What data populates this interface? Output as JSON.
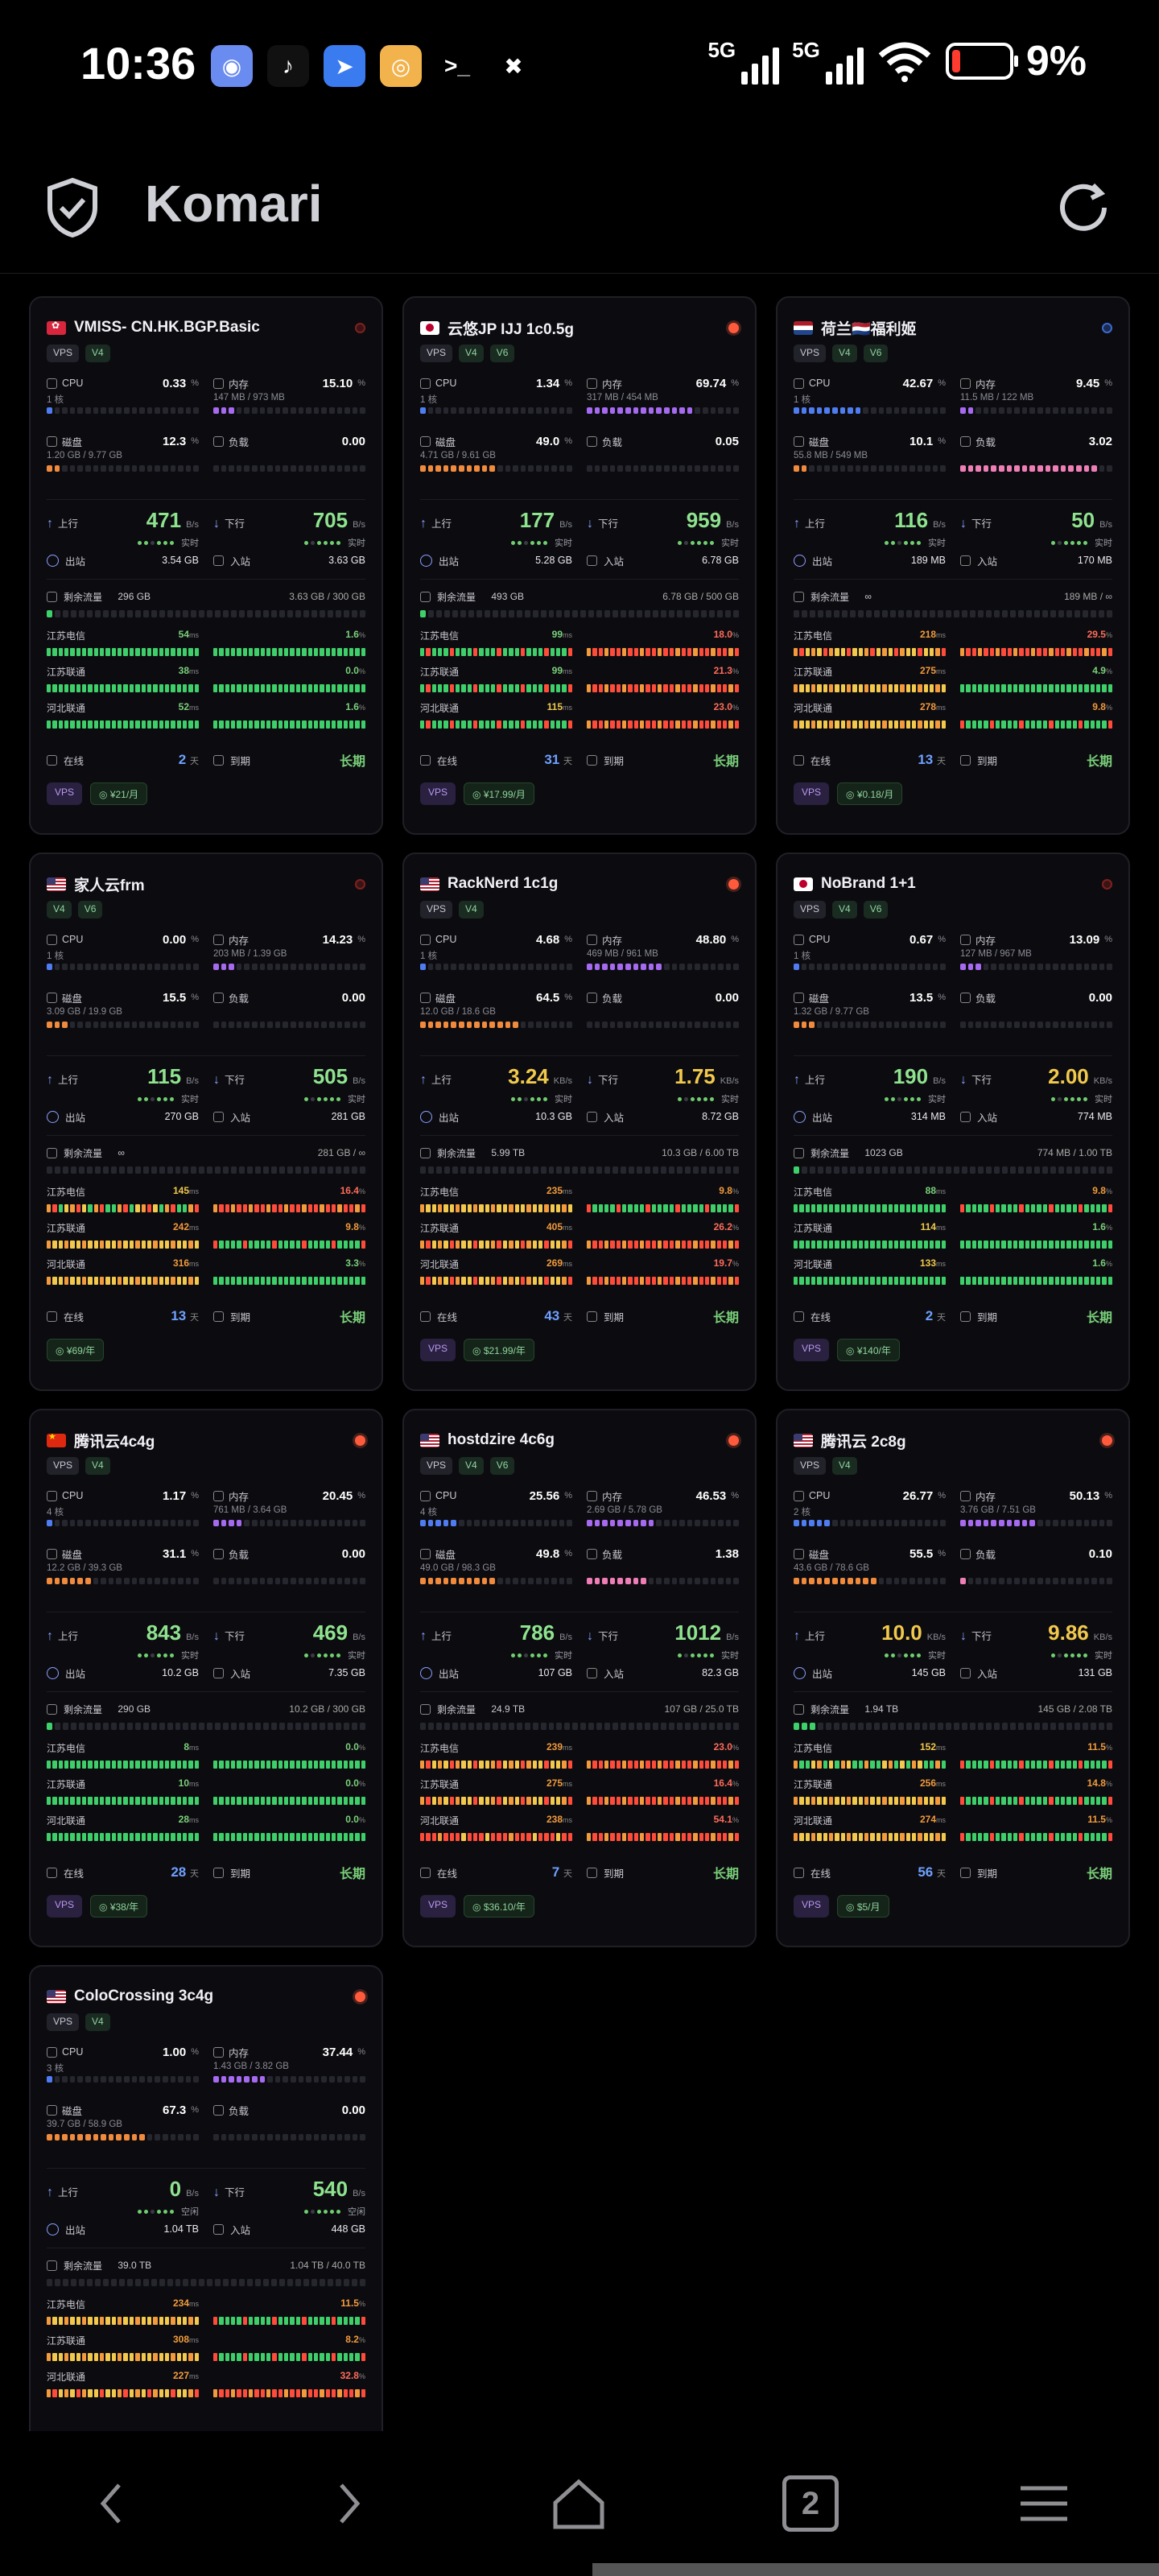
{
  "status_bar": {
    "time": "10:36",
    "net1": "5G",
    "net2": "5G",
    "wifi_sub": "7",
    "battery": "9%"
  },
  "app": {
    "title": "Komari"
  },
  "labels": {
    "cpu": "CPU",
    "mem": "内存",
    "disk": "磁盘",
    "load": "负载",
    "up": "上行",
    "down": "下行",
    "live": "实时",
    "idle": "空闲",
    "out": "出站",
    "in": "入站",
    "quota": "剩余流量",
    "ct": "江苏电信",
    "cu": "江苏联通",
    "cm": "河北联通",
    "online": "在线",
    "expire": "到期",
    "longterm": "长期"
  },
  "cards": [
    {
      "name": "VMISS- CN.HK.BGP.Basic",
      "flag": "hk",
      "status": "dim",
      "tags": [
        "VPS",
        "V4"
      ],
      "cpu": "0.33",
      "cores": "1 核",
      "mem": "15.10",
      "mem_sub": "147 MB / 973 MB",
      "disk": "12.3",
      "disk_sub": "1.20 GB / 9.77 GB",
      "load": "0.00",
      "up": "471",
      "up_unit": "B/s",
      "down": "705",
      "down_unit": "B/s",
      "out": "3.54 GB",
      "in": "3.63 GB",
      "quota_left": "296 GB",
      "quota_total": "3.63 GB / 300 GB",
      "quota_pct": 0.99,
      "ping": [
        [
          "54",
          "1.6"
        ],
        [
          "38",
          "0.0"
        ],
        [
          "52",
          "1.6"
        ]
      ],
      "online": "2",
      "price": "¥21/月",
      "live_status": "实时"
    },
    {
      "name": "云悠JP IJJ 1c0.5g",
      "flag": "jp",
      "status": "red",
      "tags": [
        "VPS",
        "V4",
        "V6"
      ],
      "cpu": "1.34",
      "cores": "1 核",
      "mem": "69.74",
      "mem_sub": "317 MB / 454 MB",
      "disk": "49.0",
      "disk_sub": "4.71 GB / 9.61 GB",
      "load": "0.05",
      "up": "177",
      "up_unit": "B/s",
      "down": "959",
      "down_unit": "B/s",
      "out": "5.28 GB",
      "in": "6.78 GB",
      "quota_left": "493 GB",
      "quota_total": "6.78 GB / 500 GB",
      "quota_pct": 0.99,
      "ping": [
        [
          "99",
          "18.0"
        ],
        [
          "99",
          "21.3"
        ],
        [
          "115",
          "23.0"
        ]
      ],
      "online": "31",
      "price": "¥17.99/月",
      "live_status": "实时"
    },
    {
      "name": "荷兰🇳🇱福利姬",
      "flag": "nl",
      "status": "blue",
      "tags": [
        "VPS",
        "V4",
        "V6"
      ],
      "cpu": "42.67",
      "cores": "1 核",
      "mem": "9.45",
      "mem_sub": "11.5 MB / 122 MB",
      "disk": "10.1",
      "disk_sub": "55.8 MB / 549 MB",
      "load": "3.02",
      "up": "116",
      "up_unit": "B/s",
      "down": "50",
      "down_unit": "B/s",
      "out": "189 MB",
      "in": "170 MB",
      "quota_left": "∞",
      "quota_total": "189 MB / ∞",
      "quota_pct": 0,
      "ping": [
        [
          "218",
          "29.5"
        ],
        [
          "275",
          "4.9"
        ],
        [
          "278",
          "9.8"
        ]
      ],
      "online": "13",
      "price": "¥0.18/月",
      "live_status": "实时"
    },
    {
      "name": "家人云frm",
      "flag": "us",
      "status": "dim",
      "tags": [
        "V4",
        "V6"
      ],
      "cpu": "0.00",
      "cores": "1 核",
      "mem": "14.23",
      "mem_sub": "203 MB / 1.39 GB",
      "disk": "15.5",
      "disk_sub": "3.09 GB / 19.9 GB",
      "load": "0.00",
      "up": "115",
      "up_unit": "B/s",
      "down": "505",
      "down_unit": "B/s",
      "out": "270 GB",
      "in": "281 GB",
      "quota_left": "∞",
      "quota_total": "281 GB / ∞",
      "quota_pct": 0,
      "ping": [
        [
          "145",
          "16.4"
        ],
        [
          "242",
          "9.8"
        ],
        [
          "316",
          "3.3"
        ]
      ],
      "online": "13",
      "price": "¥69/年",
      "live_status": "实时"
    },
    {
      "name": "RackNerd 1c1g",
      "flag": "us",
      "status": "red",
      "tags": [
        "VPS",
        "V4"
      ],
      "cpu": "4.68",
      "cores": "1 核",
      "mem": "48.80",
      "mem_sub": "469 MB / 961 MB",
      "disk": "64.5",
      "disk_sub": "12.0 GB / 18.6 GB",
      "load": "0.00",
      "up": "3.24",
      "up_unit": "KB/s",
      "down": "1.75",
      "down_unit": "KB/s",
      "out": "10.3 GB",
      "in": "8.72 GB",
      "quota_left": "5.99 TB",
      "quota_total": "10.3 GB / 6.00 TB",
      "quota_pct": 0,
      "ping": [
        [
          "235",
          "9.8"
        ],
        [
          "405",
          "26.2"
        ],
        [
          "269",
          "19.7"
        ]
      ],
      "online": "43",
      "price": "$21.99/年",
      "live_status": "实时"
    },
    {
      "name": "NoBrand 1+1",
      "flag": "jp",
      "status": "dim",
      "tags": [
        "VPS",
        "V4",
        "V6"
      ],
      "cpu": "0.67",
      "cores": "1 核",
      "mem": "13.09",
      "mem_sub": "127 MB / 967 MB",
      "disk": "13.5",
      "disk_sub": "1.32 GB / 9.77 GB",
      "load": "0.00",
      "up": "190",
      "up_unit": "B/s",
      "down": "2.00",
      "down_unit": "KB/s",
      "out": "314 MB",
      "in": "774 MB",
      "quota_left": "1023 GB",
      "quota_total": "774 MB / 1.00 TB",
      "quota_pct": 0.99,
      "ping": [
        [
          "88",
          "9.8"
        ],
        [
          "114",
          "1.6"
        ],
        [
          "133",
          "1.6"
        ]
      ],
      "online": "2",
      "price": "¥140/年",
      "live_status": "实时"
    },
    {
      "name": "腾讯云4c4g",
      "flag": "cn",
      "status": "red",
      "tags": [
        "VPS",
        "V4"
      ],
      "cpu": "1.17",
      "cores": "4 核",
      "mem": "20.45",
      "mem_sub": "761 MB / 3.64 GB",
      "disk": "31.1",
      "disk_sub": "12.2 GB / 39.3 GB",
      "load": "0.00",
      "up": "843",
      "up_unit": "B/s",
      "down": "469",
      "down_unit": "B/s",
      "out": "10.2 GB",
      "in": "7.35 GB",
      "quota_left": "290 GB",
      "quota_total": "10.2 GB / 300 GB",
      "quota_pct": 0.97,
      "ping": [
        [
          "8",
          "0.0"
        ],
        [
          "10",
          "0.0"
        ],
        [
          "28",
          "0.0"
        ]
      ],
      "online": "28",
      "price": "¥38/年",
      "live_status": "实时"
    },
    {
      "name": "hostdzire 4c6g",
      "flag": "us",
      "status": "red",
      "tags": [
        "VPS",
        "V4",
        "V6"
      ],
      "cpu": "25.56",
      "cores": "4 核",
      "mem": "46.53",
      "mem_sub": "2.69 GB / 5.78 GB",
      "disk": "49.8",
      "disk_sub": "49.0 GB / 98.3 GB",
      "load": "1.38",
      "up": "786",
      "up_unit": "B/s",
      "down": "1012",
      "down_unit": "B/s",
      "out": "107 GB",
      "in": "82.3 GB",
      "quota_left": "24.9 TB",
      "quota_total": "107 GB / 25.0 TB",
      "quota_pct": 0,
      "ping": [
        [
          "239",
          "23.0"
        ],
        [
          "275",
          "16.4"
        ],
        [
          "238",
          "54.1"
        ]
      ],
      "online": "7",
      "price": "$36.10/年",
      "live_status": "实时"
    },
    {
      "name": "腾讯云 2c8g",
      "flag": "us",
      "status": "red",
      "tags": [
        "VPS",
        "V4"
      ],
      "cpu": "26.77",
      "cores": "2 核",
      "mem": "50.13",
      "mem_sub": "3.76 GB / 7.51 GB",
      "disk": "55.5",
      "disk_sub": "43.6 GB / 78.6 GB",
      "load": "0.10",
      "up": "10.0",
      "up_unit": "KB/s",
      "down": "9.86",
      "down_unit": "KB/s",
      "out": "145 GB",
      "in": "131 GB",
      "quota_left": "1.94 TB",
      "quota_total": "145 GB / 2.08 TB",
      "quota_pct": 0.93,
      "ping": [
        [
          "152",
          "11.5"
        ],
        [
          "256",
          "14.8"
        ],
        [
          "274",
          "11.5"
        ]
      ],
      "online": "56",
      "price": "$5/月",
      "live_status": "实时"
    },
    {
      "name": "ColoCrossing 3c4g",
      "flag": "us",
      "status": "red",
      "tags": [
        "VPS",
        "V4"
      ],
      "cpu": "1.00",
      "cores": "3 核",
      "mem": "37.44",
      "mem_sub": "1.43 GB / 3.82 GB",
      "disk": "67.3",
      "disk_sub": "39.7 GB / 58.9 GB",
      "load": "0.00",
      "up": "0",
      "up_unit": "B/s",
      "down": "540",
      "down_unit": "B/s",
      "out": "1.04 TB",
      "in": "448 GB",
      "quota_left": "39.0 TB",
      "quota_total": "1.04 TB / 40.0 TB",
      "quota_pct": 0,
      "ping": [
        [
          "234",
          "11.5"
        ],
        [
          "308",
          "8.2"
        ],
        [
          "227",
          "32.8"
        ]
      ],
      "online": "",
      "price": "",
      "live_status": "空闲"
    }
  ],
  "nav": {
    "tab_count": "2"
  }
}
